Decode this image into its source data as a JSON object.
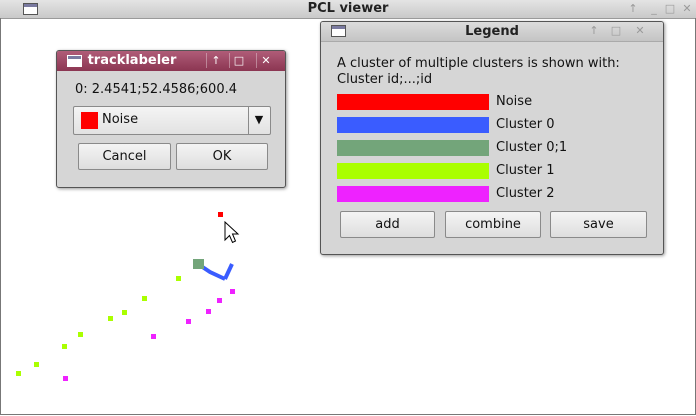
{
  "main_window": {
    "title": "PCL viewer"
  },
  "tracklabeler": {
    "title": "tracklabeler",
    "coordinates": "0: 2.4541;52.4586;600.4",
    "select": {
      "value": "Noise",
      "color": "#ff0000"
    },
    "cancel_label": "Cancel",
    "ok_label": "OK",
    "title_color": "#9c4764"
  },
  "legend": {
    "title": "Legend",
    "description_line1": "A cluster of multiple clusters is shown with:",
    "description_line2": "Cluster id;...;id",
    "items": [
      {
        "label": "Noise",
        "color": "#ff0000"
      },
      {
        "label": "Cluster 0",
        "color": "#3a5cff"
      },
      {
        "label": "Cluster 0;1",
        "color": "#73a57a"
      },
      {
        "label": "Cluster 1",
        "color": "#aaff00"
      },
      {
        "label": "Cluster 2",
        "color": "#ee22ff"
      }
    ],
    "add_label": "add",
    "combine_label": "combine",
    "save_label": "save"
  }
}
